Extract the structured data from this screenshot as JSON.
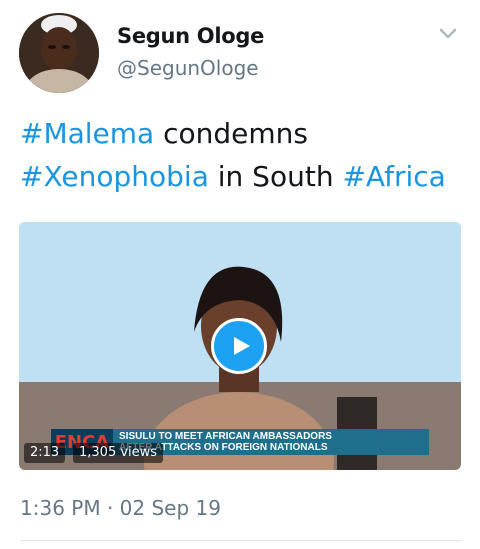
{
  "author": {
    "name": "Segun Ologe",
    "handle": "@SegunOloge",
    "avatar": "avatar-icon"
  },
  "tweet": {
    "parts": [
      {
        "text": "#Malema",
        "type": "hashtag"
      },
      {
        "text": " condemns ",
        "type": "text"
      },
      {
        "text": "#Xenophobia",
        "type": "hashtag"
      },
      {
        "text": " in South ",
        "type": "text"
      },
      {
        "text": "#Africa",
        "type": "hashtag"
      }
    ],
    "timestamp": "1:36 PM · 02 Sep 19"
  },
  "media": {
    "duration": "2:13",
    "views": "1,305 views",
    "lower_third": {
      "logo": "ENCA",
      "headline_1": "SISULU TO MEET AFRICAN AMBASSADORS",
      "headline_2": "AFTER ATTACKS ON FOREIGN NATIONALS"
    }
  },
  "colors": {
    "hashtag": "#1b95e0",
    "play_button": "#1da1f2",
    "secondary_text": "#657786"
  },
  "icons": {
    "menu": "chevron-down-icon",
    "play": "play-icon"
  }
}
